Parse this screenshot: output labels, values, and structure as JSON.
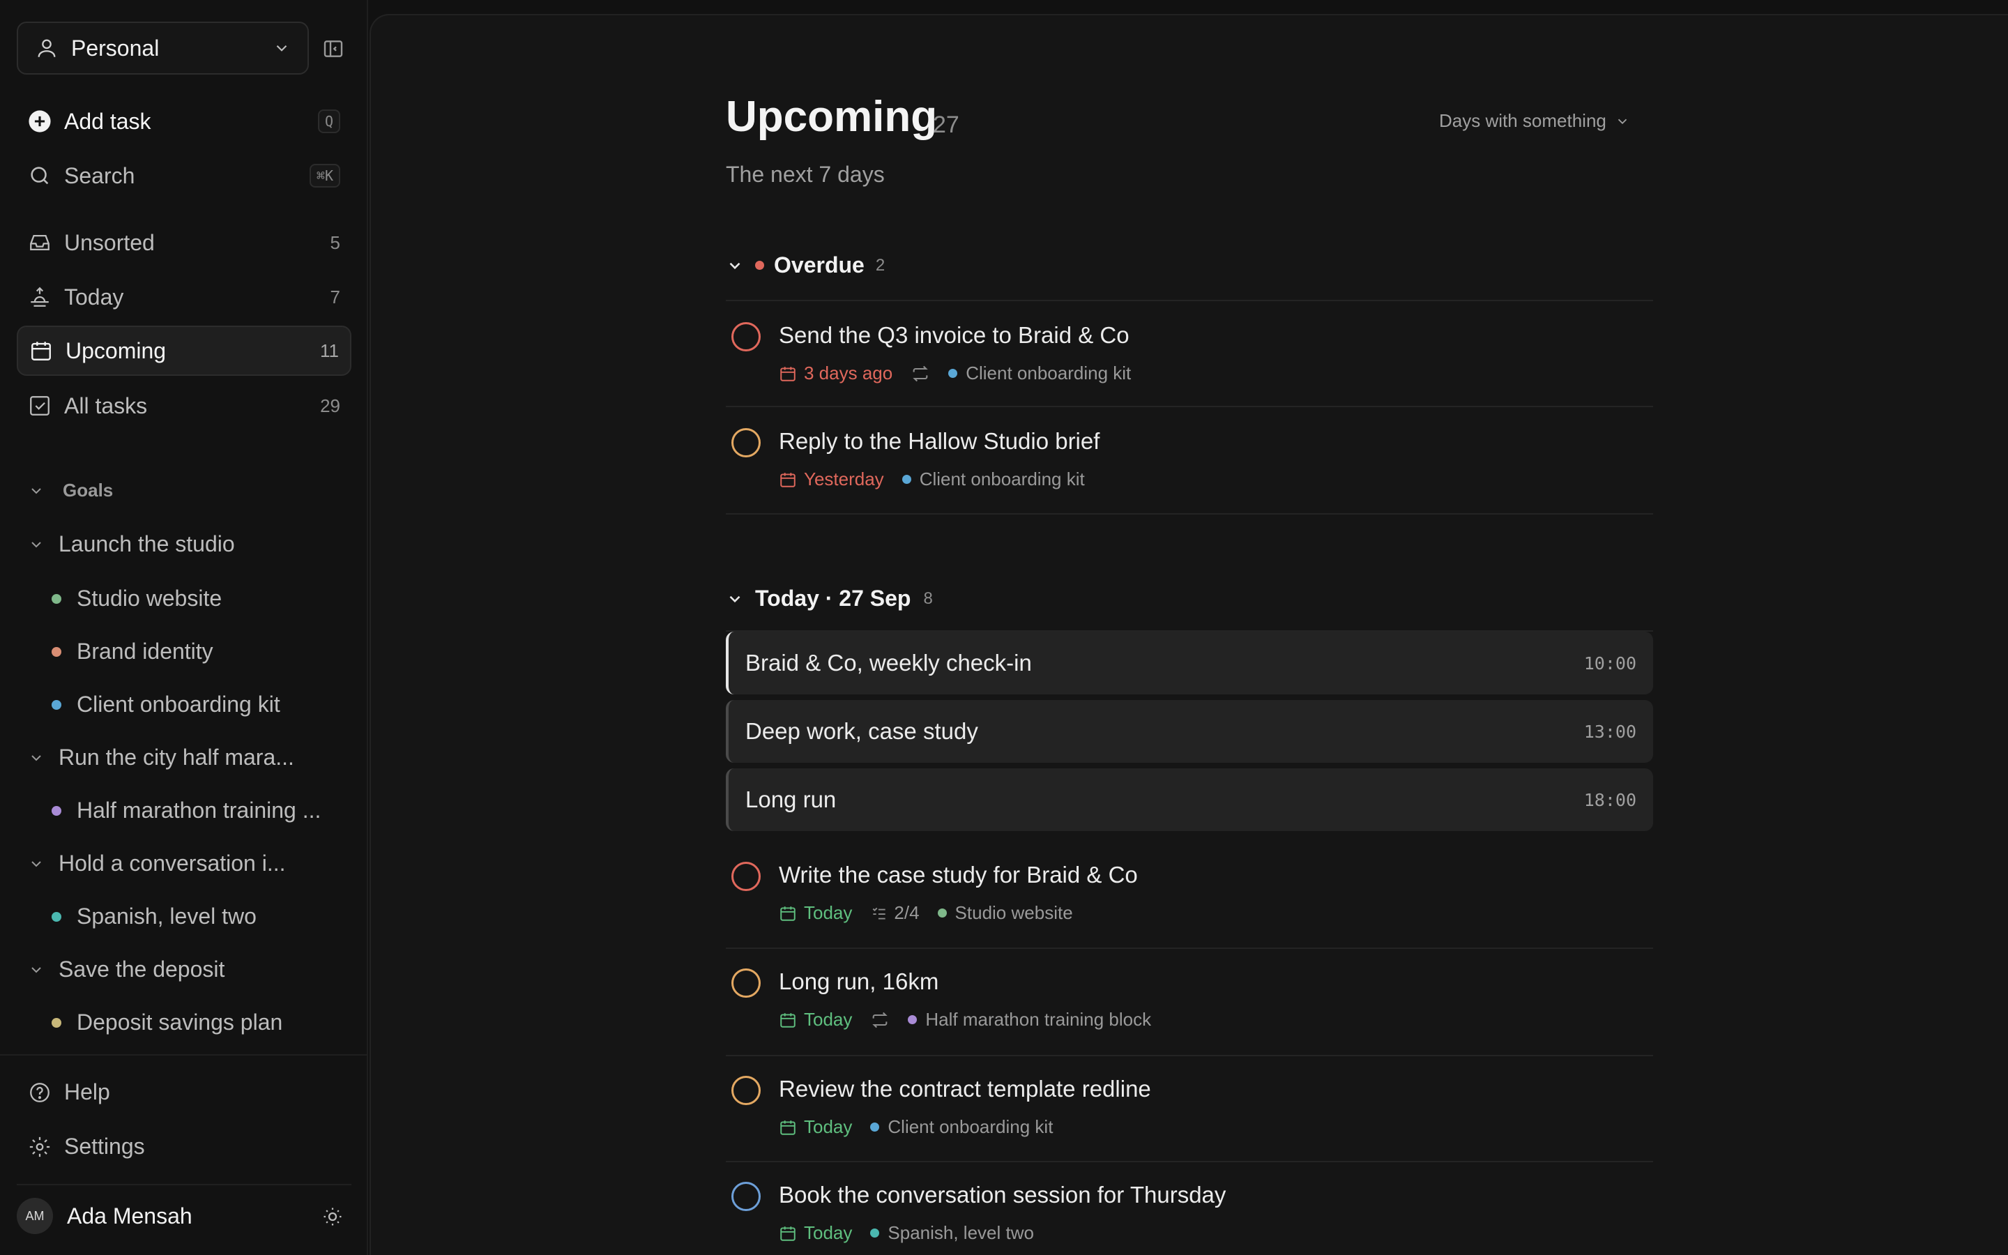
{
  "colors": {
    "bg": "#111111",
    "main_bg": "#151515",
    "overdue": "#e0685c",
    "today": "#5fbf7f",
    "prio_high": "#e0685c",
    "prio_med": "#e3a862",
    "prio_low": "#6d9fd8"
  },
  "sidebar": {
    "workspace": {
      "label": "Personal",
      "icon": "person-icon"
    },
    "add_task": {
      "label": "Add task",
      "shortcut": "Q"
    },
    "search": {
      "label": "Search",
      "shortcut": "⌘K"
    },
    "nav": [
      {
        "label": "Unsorted",
        "count": "5",
        "icon": "inbox-icon"
      },
      {
        "label": "Today",
        "count": "7",
        "icon": "sunrise-icon"
      },
      {
        "label": "Upcoming",
        "count": "11",
        "icon": "calendar-icon"
      },
      {
        "label": "All tasks",
        "count": "29",
        "icon": "checkbox-icon"
      }
    ],
    "goals_label": "Goals",
    "goals": [
      {
        "label": "Launch the studio",
        "projects": [
          {
            "label": "Studio website",
            "color": "#7fb88a"
          },
          {
            "label": "Brand identity",
            "color": "#d98e74"
          },
          {
            "label": "Client onboarding kit",
            "color": "#5aa7d6"
          }
        ]
      },
      {
        "label": "Run the city half mara...",
        "projects": [
          {
            "label": "Half marathon training ...",
            "color": "#a98bd6"
          }
        ]
      },
      {
        "label": "Hold a conversation i...",
        "projects": [
          {
            "label": "Spanish, level two",
            "color": "#4bb8b0"
          }
        ]
      },
      {
        "label": "Save the deposit",
        "projects": [
          {
            "label": "Deposit savings plan",
            "color": "#c8b87a"
          }
        ]
      }
    ],
    "help": "Help",
    "settings": "Settings",
    "user": {
      "initials": "AM",
      "name": "Ada Mensah"
    }
  },
  "main": {
    "title": "Upcoming",
    "count": "27",
    "subtitle": "The next 7 days",
    "filter": "Days with something",
    "overdue": {
      "title": "Overdue",
      "count": "2",
      "tasks": [
        {
          "title": "Send the Q3 invoice to Braid & Co",
          "due": "3 days ago",
          "repeat": true,
          "project": "Client onboarding kit",
          "project_color": "#5aa7d6",
          "priority": "high"
        },
        {
          "title": "Reply to the Hallow Studio brief",
          "due": "Yesterday",
          "repeat": false,
          "project": "Client onboarding kit",
          "project_color": "#5aa7d6",
          "priority": "medium"
        }
      ]
    },
    "today": {
      "title": "Today · 27 Sep",
      "count": "8",
      "events": [
        {
          "title": "Braid & Co, weekly check-in",
          "time": "10:00"
        },
        {
          "title": "Deep work, case study",
          "time": "13:00"
        },
        {
          "title": "Long run",
          "time": "18:00"
        }
      ],
      "tasks": [
        {
          "title": "Write the case study for Braid & Co",
          "due": "Today",
          "subtasks": "2/4",
          "project": "Studio website",
          "project_color": "#7fb88a",
          "priority": "high"
        },
        {
          "title": "Long run, 16km",
          "due": "Today",
          "repeat": true,
          "project": "Half marathon training block",
          "project_color": "#a98bd6",
          "priority": "medium"
        },
        {
          "title": "Review the contract template redline",
          "due": "Today",
          "project": "Client onboarding kit",
          "project_color": "#5aa7d6",
          "priority": "medium"
        },
        {
          "title": "Book the conversation session for Thursday",
          "due": "Today",
          "project": "Spanish, level two",
          "project_color": "#4bb8b0",
          "priority": "low"
        }
      ]
    }
  }
}
